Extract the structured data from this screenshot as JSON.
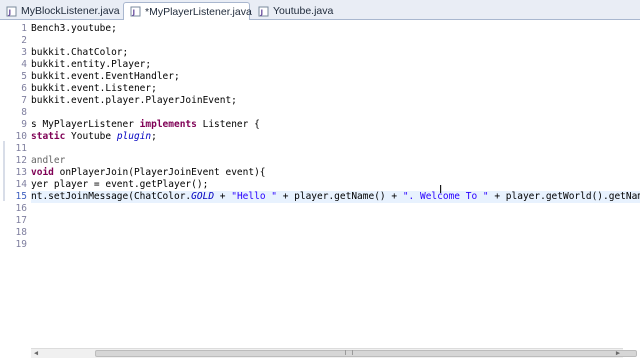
{
  "tabs": [
    {
      "label": "MyBlockListener.java",
      "active": false
    },
    {
      "label": "*MyPlayerListener.java",
      "active": true
    },
    {
      "label": "Youtube.java",
      "active": false
    }
  ],
  "close_glyph": "✕",
  "line_numbers": [
    "1",
    "2",
    "3",
    "4",
    "5",
    "6",
    "7",
    "8",
    "9",
    "10",
    "11",
    "12",
    "13",
    "14",
    "15",
    "16",
    "17",
    "18",
    "19"
  ],
  "code": {
    "l1": "Bench3.youtube;",
    "l3": "bukkit.ChatColor;",
    "l4": "bukkit.entity.Player;",
    "l5": "bukkit.event.EventHandler;",
    "l6": "bukkit.event.Listener;",
    "l7": "bukkit.event.player.PlayerJoinEvent;",
    "l9_a": "s MyPlayerListener ",
    "l9_b": "implements",
    "l9_c": " Listener {",
    "l10_a": "static",
    "l10_b": " Youtube ",
    "l10_c": "plugin",
    "l10_d": ";",
    "l12": "andler",
    "l13_a": "void",
    "l13_b": " onPlayerJoin(PlayerJoinEvent event){",
    "l14": "yer player = event.getPlayer();",
    "l15_a": "nt.setJoinMessage(ChatColor.",
    "l15_b": "GOLD",
    "l15_c": " + ",
    "l15_d": "\"Hello \"",
    "l15_e": " + player.getName() + ",
    "l15_f": "\". Welcome To \"",
    "l15_g": " + player.getWorld().getName());"
  },
  "colors": {
    "keyword": "#7f0055",
    "string": "#2a00ff",
    "field": "#0000c0",
    "current_line": "#e8f2fe"
  }
}
